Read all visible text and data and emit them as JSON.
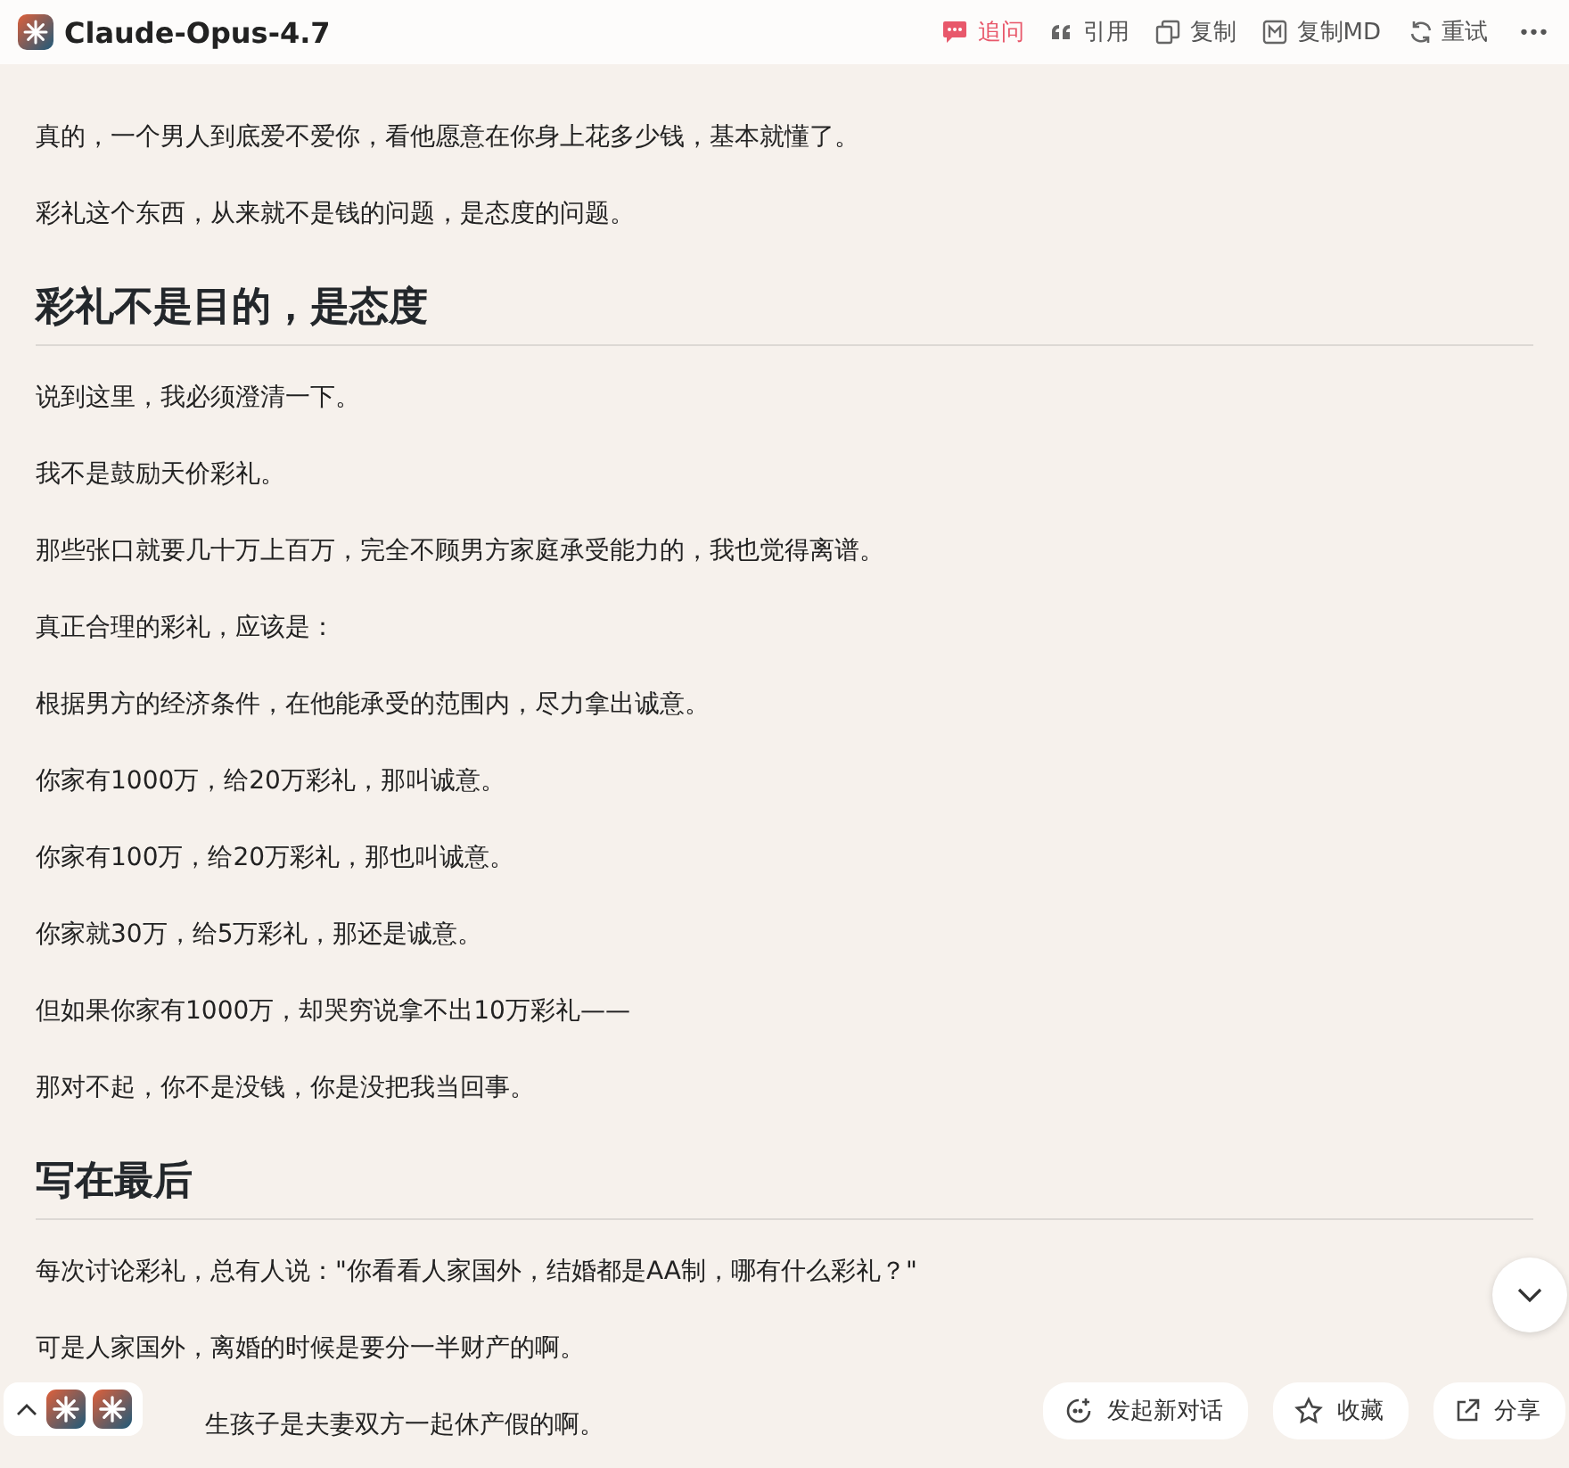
{
  "header": {
    "title": "Claude-Opus-4.7",
    "actions": [
      {
        "kind": "ask",
        "label": "追问",
        "highlighted": true
      },
      {
        "kind": "quote",
        "label": "引用",
        "highlighted": false
      },
      {
        "kind": "copy",
        "label": "复制",
        "highlighted": false
      },
      {
        "kind": "copymd",
        "label": "复制MD",
        "highlighted": false
      },
      {
        "kind": "retry",
        "label": "重试",
        "highlighted": false
      },
      {
        "kind": "more",
        "label": "•••",
        "highlighted": false
      }
    ]
  },
  "article": [
    {
      "kind": "p",
      "text": "真的，一个男人到底爱不爱你，看他愿意在你身上花多少钱，基本就懂了。"
    },
    {
      "kind": "p",
      "text": "彩礼这个东西，从来就不是钱的问题，是态度的问题。"
    },
    {
      "kind": "h2",
      "text": "彩礼不是目的，是态度"
    },
    {
      "kind": "p",
      "text": "说到这里，我必须澄清一下。"
    },
    {
      "kind": "p",
      "text": "我不是鼓励天价彩礼。"
    },
    {
      "kind": "p",
      "text": "那些张口就要几十万上百万，完全不顾男方家庭承受能力的，我也觉得离谱。"
    },
    {
      "kind": "p",
      "text": "真正合理的彩礼，应该是："
    },
    {
      "kind": "p",
      "text": "根据男方的经济条件，在他能承受的范围内，尽力拿出诚意。"
    },
    {
      "kind": "p",
      "text": "你家有1000万，给20万彩礼，那叫诚意。"
    },
    {
      "kind": "p",
      "text": "你家有100万，给20万彩礼，那也叫诚意。"
    },
    {
      "kind": "p",
      "text": "你家就30万，给5万彩礼，那还是诚意。"
    },
    {
      "kind": "p",
      "text": "但如果你家有1000万，却哭穷说拿不出10万彩礼——"
    },
    {
      "kind": "p",
      "text": "那对不起，你不是没钱，你是没把我当回事。"
    },
    {
      "kind": "h2",
      "text": "写在最后"
    },
    {
      "kind": "p",
      "text": "每次讨论彩礼，总有人说：\"你看看人家国外，结婚都是AA制，哪有什么彩礼？\""
    },
    {
      "kind": "p",
      "text": "可是人家国外，离婚的时候是要分一半财产的啊。"
    },
    {
      "kind": "covered",
      "text": "生孩子是夫妻双方一起休产假的啊。"
    }
  ],
  "bottom_actions": [
    {
      "kind": "new",
      "label": "发起新对话"
    },
    {
      "kind": "star",
      "label": "收藏"
    },
    {
      "kind": "share",
      "label": "分享"
    }
  ],
  "bot_switcher": {
    "expanded": false
  }
}
